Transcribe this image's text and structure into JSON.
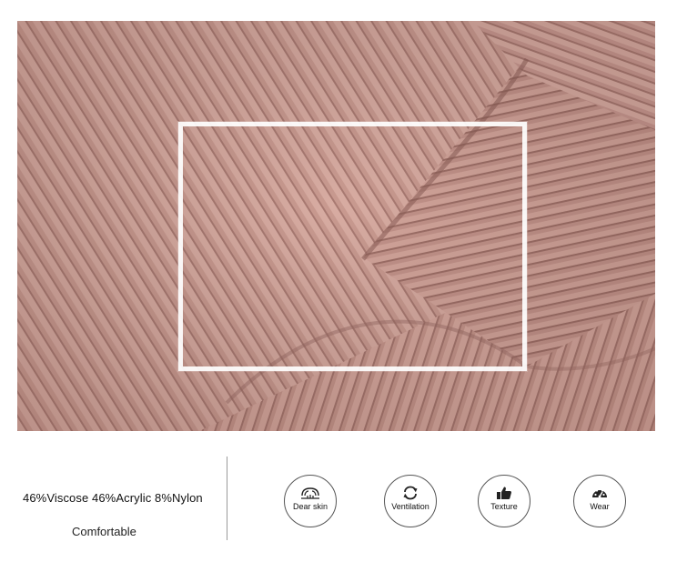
{
  "product": {
    "material": "46%Viscose 46%Acrylic 8%Nylon",
    "tagline": "Comfortable",
    "fabric_color": "#c8988e"
  },
  "features": [
    {
      "label": "Dear skin",
      "icon": "skin-icon"
    },
    {
      "label": "Ventilation",
      "icon": "ventilation-icon"
    },
    {
      "label": "Texture",
      "icon": "thumbs-up-icon"
    },
    {
      "label": "Wear",
      "icon": "wear-dial-icon"
    }
  ]
}
